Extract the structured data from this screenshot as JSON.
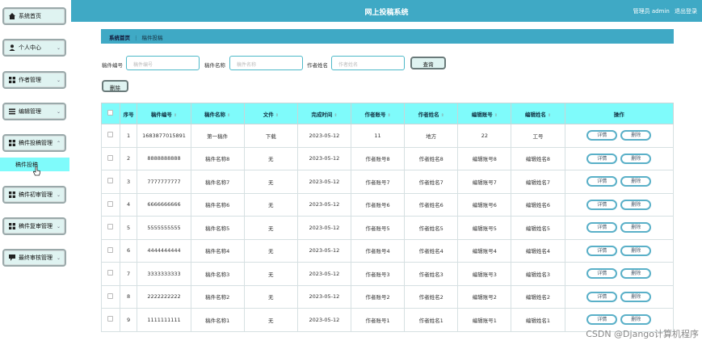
{
  "header": {
    "title": "网上投稿系统",
    "admin_label": "管理员 admin",
    "logout": "退出登录"
  },
  "sidebar": {
    "items": [
      {
        "label": "系统首页",
        "icon": "home-icon"
      },
      {
        "label": "个人中心",
        "icon": "user-icon"
      },
      {
        "label": "作者管理",
        "icon": "grid-icon"
      },
      {
        "label": "编辑管理",
        "icon": "list-icon"
      },
      {
        "label": "稿件投稿管理",
        "icon": "grid-icon"
      },
      {
        "label": "稿件初审管理",
        "icon": "grid-icon"
      },
      {
        "label": "稿件复审管理",
        "icon": "grid-icon"
      },
      {
        "label": "最终审核管理",
        "icon": "chat-icon"
      }
    ],
    "active_sub": "稿件投稿"
  },
  "breadcrumb": {
    "home": "系统首页",
    "current": "稿件投稿"
  },
  "search": {
    "label1": "稿件编号",
    "ph1": "稿件编号",
    "label2": "稿件名称",
    "ph2": "稿件名称",
    "label3": "作者姓名",
    "ph3": "作者姓名",
    "query_button": "查询",
    "delete_button": "删除"
  },
  "table": {
    "headers": [
      "序号",
      "稿件编号",
      "稿件名称",
      "文件",
      "完成时间",
      "作者账号",
      "作者姓名",
      "编辑账号",
      "编辑姓名",
      "操作"
    ],
    "rows": [
      {
        "no": "1",
        "code": "1683877015891",
        "name": "第一稿件",
        "file": "下载",
        "date": "2023-05-12",
        "author_acc": "11",
        "author_name": "地方",
        "editor_acc": "22",
        "editor_name": "工号"
      },
      {
        "no": "2",
        "code": "8888888888",
        "name": "稿件名称8",
        "file": "无",
        "date": "2023-05-12",
        "author_acc": "作者账号8",
        "author_name": "作者姓名8",
        "editor_acc": "编辑账号8",
        "editor_name": "编辑姓名8"
      },
      {
        "no": "3",
        "code": "7777777777",
        "name": "稿件名称7",
        "file": "无",
        "date": "2023-05-12",
        "author_acc": "作者账号7",
        "author_name": "作者姓名7",
        "editor_acc": "编辑账号7",
        "editor_name": "编辑姓名7"
      },
      {
        "no": "4",
        "code": "6666666666",
        "name": "稿件名称6",
        "file": "无",
        "date": "2023-05-12",
        "author_acc": "作者账号6",
        "author_name": "作者姓名6",
        "editor_acc": "编辑账号6",
        "editor_name": "编辑姓名6"
      },
      {
        "no": "5",
        "code": "5555555555",
        "name": "稿件名称5",
        "file": "无",
        "date": "2023-05-12",
        "author_acc": "作者账号5",
        "author_name": "作者姓名5",
        "editor_acc": "编辑账号5",
        "editor_name": "编辑姓名5"
      },
      {
        "no": "6",
        "code": "4444444444",
        "name": "稿件名称4",
        "file": "无",
        "date": "2023-05-12",
        "author_acc": "作者账号4",
        "author_name": "作者姓名4",
        "editor_acc": "编辑账号4",
        "editor_name": "编辑姓名4"
      },
      {
        "no": "7",
        "code": "3333333333",
        "name": "稿件名称3",
        "file": "无",
        "date": "2023-05-12",
        "author_acc": "作者账号3",
        "author_name": "作者姓名3",
        "editor_acc": "编辑账号3",
        "editor_name": "编辑姓名3"
      },
      {
        "no": "8",
        "code": "2222222222",
        "name": "稿件名称2",
        "file": "无",
        "date": "2023-05-12",
        "author_acc": "作者账号2",
        "author_name": "作者姓名2",
        "editor_acc": "编辑账号2",
        "editor_name": "编辑姓名2"
      },
      {
        "no": "9",
        "code": "1111111111",
        "name": "稿件名称1",
        "file": "无",
        "date": "2023-05-12",
        "author_acc": "作者账号1",
        "author_name": "作者姓名1",
        "editor_acc": "编辑账号1",
        "editor_name": "编辑姓名1"
      }
    ],
    "detail_label": "详情",
    "delete_label": "删除"
  },
  "watermark": "CSDN @Django计算机程序",
  "colors": {
    "header": "#3fa9c5",
    "table_header": "#7ffbfb",
    "nav_button": "#dff3f1",
    "active_sub": "#7ffbfb"
  }
}
